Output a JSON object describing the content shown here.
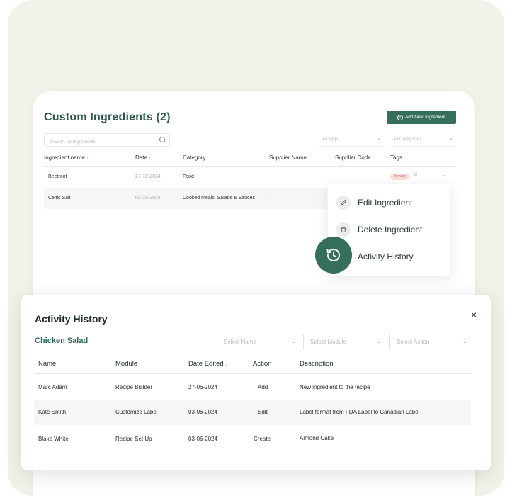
{
  "ingredients": {
    "title": "Custom Ingredients (2)",
    "add_button": "Add New Ingredient",
    "search_placeholder": "Search for Ingredients",
    "filter_tags": "All Tags",
    "filter_categories": "All Categories",
    "columns": [
      "Ingredient name",
      "Date",
      "Category",
      "Supplier Name",
      "Supplier Code",
      "Tags"
    ],
    "rows": [
      {
        "name": "Beetroot",
        "date": "27-10-2024",
        "category": "Food",
        "supplier_name": "-",
        "supplier_code": "-",
        "tag": "Tomato",
        "tag_more": "+3"
      },
      {
        "name": "Celtic Salt",
        "date": "03-10-2024",
        "category": "Cooked meals, Salads & Sauces",
        "supplier_name": "-",
        "supplier_code": "",
        "tag": "",
        "tag_more": ""
      }
    ],
    "row_menu_dots": "···"
  },
  "context_menu": {
    "items": [
      "Edit Ingredient",
      "Delete Ingredient",
      "Activity History"
    ]
  },
  "activity": {
    "title": "Activity History",
    "close": "×",
    "recipe": "Chicken Salad",
    "filters": [
      "Select Name",
      "Select Module",
      "Select Action"
    ],
    "columns": [
      "Name",
      "Module",
      "Date Edited",
      "Action",
      "Description"
    ],
    "rows": [
      {
        "name": "Marc Adam",
        "module": "Recipe Builder",
        "date": "27-06-2024",
        "action": "Add",
        "description": "New ingredient to the recipe"
      },
      {
        "name": "Kate Smith",
        "module": "Customize Label",
        "date": "03-06-2024",
        "action": "Edit",
        "description": "Label format from FDA Label to Canadian Label"
      },
      {
        "name": "Blake White",
        "module": "Recipe Set Up",
        "date": "03-06-2024",
        "action": "Create",
        "description": "Almond Cake"
      }
    ]
  },
  "colors": {
    "brand_green": "#356f5c",
    "background": "#f3f2ea"
  },
  "icons": [
    "search-icon",
    "plus-circle-icon",
    "chevron-down-icon",
    "sort-icon",
    "pencil-icon",
    "trash-icon",
    "history-icon",
    "close-icon",
    "more-icon"
  ]
}
